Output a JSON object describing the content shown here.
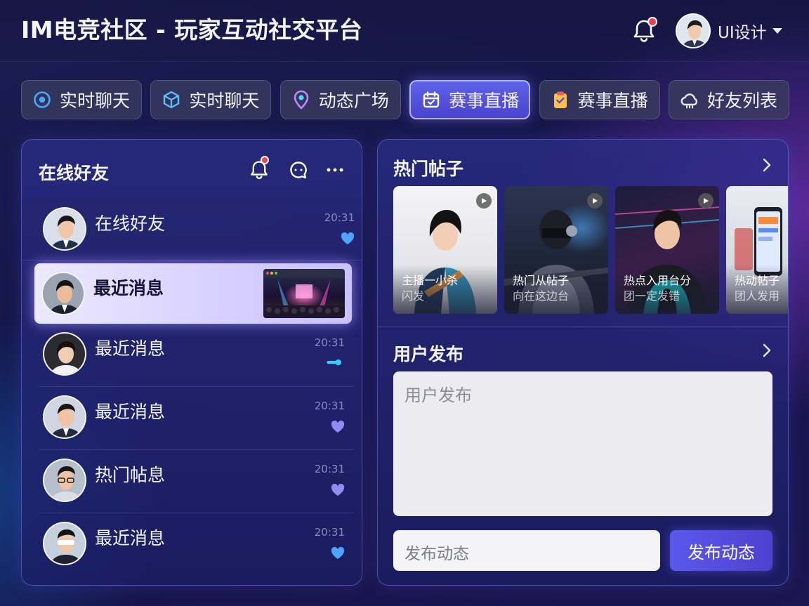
{
  "header": {
    "title": "IM电竞社区 - 玩家互动社交平台",
    "notification_icon": "bell-icon",
    "user_name": "UI设计"
  },
  "tabs": [
    {
      "label": "实时聊天",
      "icon": "target-icon",
      "active": false
    },
    {
      "label": "实时聊天",
      "icon": "cube-icon",
      "active": false
    },
    {
      "label": "动态广场",
      "icon": "location-pin-icon",
      "active": false
    },
    {
      "label": "赛事直播",
      "icon": "calendar-icon",
      "active": true
    },
    {
      "label": "赛事直播",
      "icon": "clipboard-icon",
      "active": false
    },
    {
      "label": "好友列表",
      "icon": "cloud-icon",
      "active": false
    }
  ],
  "friends_panel": {
    "title": "在线好友",
    "icons": [
      "bell-icon",
      "chat-bubble-icon",
      "more-icon"
    ],
    "items": [
      {
        "name": "在线好友",
        "time": "20:31",
        "status_icon": "heart-icon"
      },
      {
        "name": "最近消息",
        "time": "",
        "status_icon": "live-thumbnail"
      },
      {
        "name": "最近消息",
        "time": "20:31",
        "status_icon": "toggle-icon"
      },
      {
        "name": "最近消息",
        "time": "20:31",
        "status_icon": "heart-icon"
      },
      {
        "name": "热门帖息",
        "time": "20:31",
        "status_icon": "heart-icon"
      },
      {
        "name": "最近消息",
        "time": "20:31",
        "status_icon": "heart-icon"
      }
    ]
  },
  "hot_posts": {
    "title": "热门帖子",
    "cards": [
      {
        "line1": "主播一小杀",
        "line2": "闪发"
      },
      {
        "line1": "热门从帖子",
        "line2": "向在这边台"
      },
      {
        "line1": "热点入用台分",
        "line2": "团一定发错"
      },
      {
        "line1": "热动帖子",
        "line2": "团人发用"
      }
    ]
  },
  "publish": {
    "title": "用户发布",
    "textarea_placeholder": "用户发布",
    "input_placeholder": "发布动态",
    "button_label": "发布动态"
  },
  "colors": {
    "accent": "#5a58ec",
    "heart": "#4fa3ff",
    "heart_dim": "#8f8cf5",
    "badge": "#ef3e55"
  }
}
